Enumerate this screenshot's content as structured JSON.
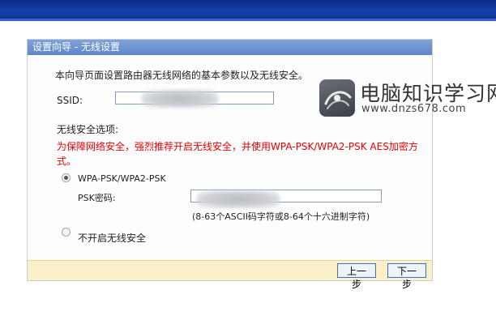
{
  "window": {
    "title": "设置向导 - 无线设置"
  },
  "content": {
    "intro": "本向导页面设置路由器无线网络的基本参数以及无线安全。",
    "ssid_label": "SSID:",
    "ssid_value": "",
    "security_section_label": "无线安全选项:",
    "security_warning": "为保障网络安全，强烈推荐开启无线安全，并使用WPA-PSK/WPA2-PSK AES加密方式。",
    "options": [
      {
        "label": "WPA-PSK/WPA2-PSK",
        "selected": true
      },
      {
        "label": "不开启无线安全",
        "selected": false
      }
    ],
    "psk_label": "PSK密码:",
    "psk_value": "",
    "psk_hint": "(8-63个ASCII码字符或8-64个十六进制字符)"
  },
  "footer": {
    "prev_label": "上一步",
    "next_label": "下一步"
  },
  "watermark": {
    "title": "电脑知识学习网",
    "url": "www.dnzs678.com"
  },
  "colors": {
    "topbar": "#143fa6",
    "title_bar": "#6b8fcc",
    "warning_text": "#e60000",
    "footer_bg": "#fbf0c8",
    "button_border": "#3a6ec4"
  },
  "icons": [
    "router-logo-watermark-icon",
    "radio-checked",
    "radio-unchecked"
  ]
}
